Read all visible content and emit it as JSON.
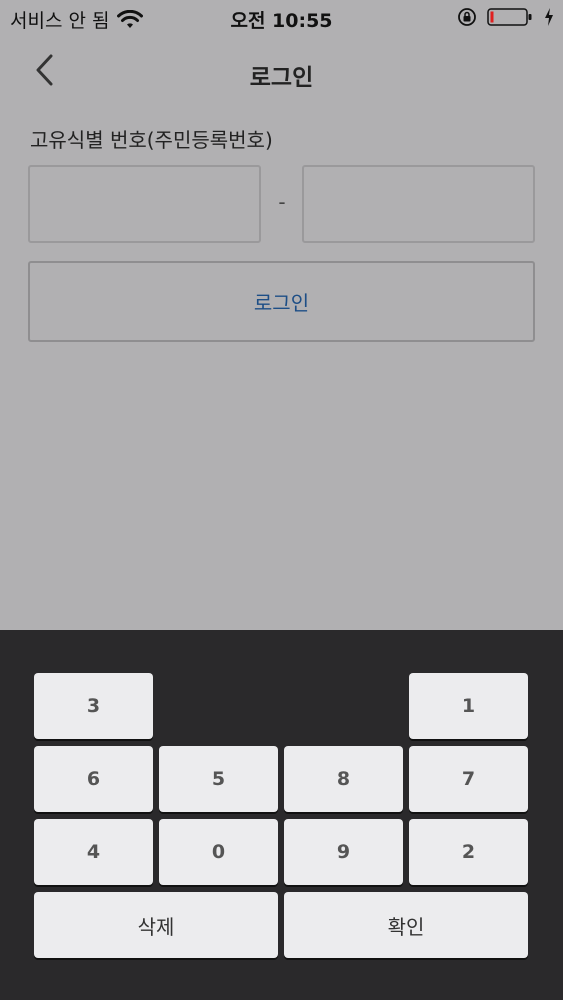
{
  "status_bar": {
    "carrier": "서비스 안 됨",
    "time": "오전 10:55"
  },
  "nav": {
    "title": "로그인"
  },
  "form": {
    "id_label": "고유식별 번호(주민등록번호)",
    "front_value": "",
    "back_value": "",
    "separator": "-",
    "login_label": "로그인"
  },
  "keypad": {
    "keys": [
      {
        "label": "3"
      },
      {
        "label": "1"
      },
      {
        "label": "6"
      },
      {
        "label": "5"
      },
      {
        "label": "8"
      },
      {
        "label": "7"
      },
      {
        "label": "4"
      },
      {
        "label": "0"
      },
      {
        "label": "9"
      },
      {
        "label": "2"
      }
    ],
    "delete_label": "삭제",
    "confirm_label": "확인"
  },
  "colors": {
    "background": "#b1b0b2",
    "keypad_background": "#2a292b",
    "key_background": "#ececee",
    "login_text": "#1d4e86"
  }
}
